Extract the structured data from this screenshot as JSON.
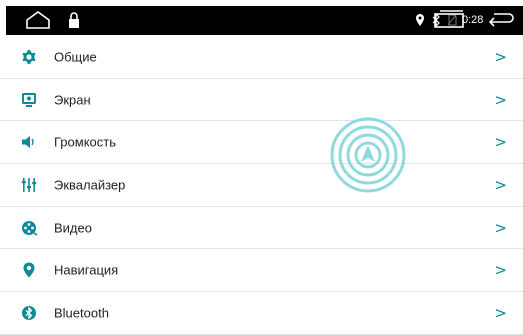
{
  "statusbar": {
    "time": "0:28"
  },
  "menu": {
    "items": [
      {
        "label": "Общие",
        "icon": "gear-icon"
      },
      {
        "label": "Экран",
        "icon": "display-icon"
      },
      {
        "label": "Громкость",
        "icon": "speaker-icon"
      },
      {
        "label": "Эквалайзер",
        "icon": "equalizer-icon"
      },
      {
        "label": "Видео",
        "icon": "film-reel-icon"
      },
      {
        "label": "Навигация",
        "icon": "location-pin-icon"
      },
      {
        "label": "Bluetooth",
        "icon": "bluetooth-icon"
      }
    ],
    "chevron": ">"
  },
  "colors": {
    "accent": "#0f8a96",
    "statusbar": "#000000"
  }
}
